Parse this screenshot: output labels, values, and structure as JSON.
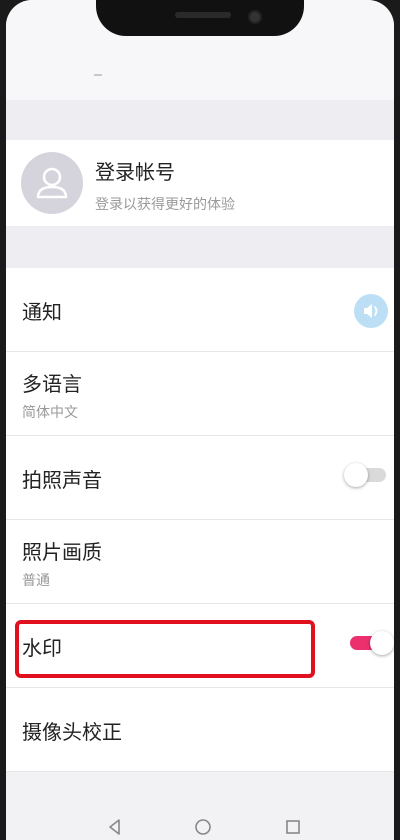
{
  "account": {
    "title": "登录帐号",
    "subtitle": "登录以获得更好的体验"
  },
  "settings": {
    "notification": {
      "label": "通知",
      "icon": "speaker-icon"
    },
    "language": {
      "label": "多语言",
      "value": "简体中文"
    },
    "shutter_sound": {
      "label": "拍照声音",
      "toggle": "off"
    },
    "photo_quality": {
      "label": "照片画质",
      "value": "普通"
    },
    "watermark": {
      "label": "水印",
      "toggle": "on"
    },
    "camera_calibration": {
      "label": "摄像头校正"
    }
  },
  "colors": {
    "accent": "#ec2f6d",
    "highlight": "#e0101e",
    "speaker_bg": "#bcdff6"
  },
  "nav": {
    "icons": [
      "back-icon",
      "home-icon",
      "recents-icon"
    ]
  }
}
